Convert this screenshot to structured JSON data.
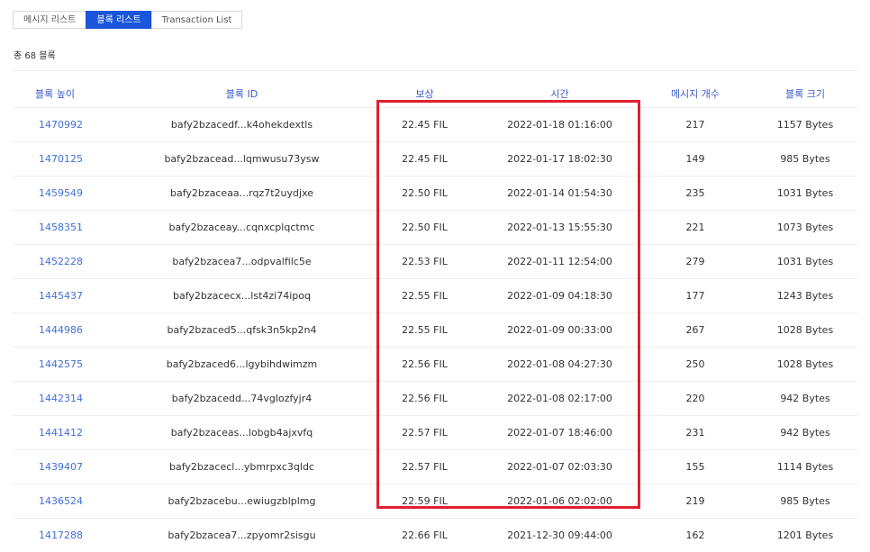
{
  "tabs": [
    {
      "label": "메시지 리스트",
      "active": false
    },
    {
      "label": "블록 리스트",
      "active": true
    },
    {
      "label": "Transaction List",
      "active": false
    }
  ],
  "summary": {
    "total_text": "총 68 블록"
  },
  "table": {
    "headers": {
      "height": "블록 높이",
      "id": "블록 ID",
      "reward": "보상",
      "time": "시간",
      "msg_count": "메시지 개수",
      "size": "블록 크기"
    },
    "rows": [
      {
        "height": "1470992",
        "id": "bafy2bzacedf...k4ohekdextls",
        "reward": "22.45 FIL",
        "time": "2022-01-18 01:16:00",
        "msg_count": "217",
        "size": "1157 Bytes"
      },
      {
        "height": "1470125",
        "id": "bafy2bzacead...lqmwusu73ysw",
        "reward": "22.45 FIL",
        "time": "2022-01-17 18:02:30",
        "msg_count": "149",
        "size": "985 Bytes"
      },
      {
        "height": "1459549",
        "id": "bafy2bzaceaa...rqz7t2uydjxe",
        "reward": "22.50 FIL",
        "time": "2022-01-14 01:54:30",
        "msg_count": "235",
        "size": "1031 Bytes"
      },
      {
        "height": "1458351",
        "id": "bafy2bzaceay...cqnxcplqctmc",
        "reward": "22.50 FIL",
        "time": "2022-01-13 15:55:30",
        "msg_count": "221",
        "size": "1073 Bytes"
      },
      {
        "height": "1452228",
        "id": "bafy2bzacea7...odpvalfilc5e",
        "reward": "22.53 FIL",
        "time": "2022-01-11 12:54:00",
        "msg_count": "279",
        "size": "1031 Bytes"
      },
      {
        "height": "1445437",
        "id": "bafy2bzacecx...lst4zi74ipoq",
        "reward": "22.55 FIL",
        "time": "2022-01-09 04:18:30",
        "msg_count": "177",
        "size": "1243 Bytes"
      },
      {
        "height": "1444986",
        "id": "bafy2bzaced5...qfsk3n5kp2n4",
        "reward": "22.55 FIL",
        "time": "2022-01-09 00:33:00",
        "msg_count": "267",
        "size": "1028 Bytes"
      },
      {
        "height": "1442575",
        "id": "bafy2bzaced6...lgybihdwimzm",
        "reward": "22.56 FIL",
        "time": "2022-01-08 04:27:30",
        "msg_count": "250",
        "size": "1028 Bytes"
      },
      {
        "height": "1442314",
        "id": "bafy2bzacedd...74vglozfyjr4",
        "reward": "22.56 FIL",
        "time": "2022-01-08 02:17:00",
        "msg_count": "220",
        "size": "942 Bytes"
      },
      {
        "height": "1441412",
        "id": "bafy2bzaceas...lobgb4ajxvfq",
        "reward": "22.57 FIL",
        "time": "2022-01-07 18:46:00",
        "msg_count": "231",
        "size": "942 Bytes"
      },
      {
        "height": "1439407",
        "id": "bafy2bzacecl...ybmrpxc3qldc",
        "reward": "22.57 FIL",
        "time": "2022-01-07 02:03:30",
        "msg_count": "155",
        "size": "1114 Bytes"
      },
      {
        "height": "1436524",
        "id": "bafy2bzacebu...ewiugzblplmg",
        "reward": "22.59 FIL",
        "time": "2022-01-06 02:02:00",
        "msg_count": "219",
        "size": "985 Bytes"
      },
      {
        "height": "1417288",
        "id": "bafy2bzacea7...zpyomr2sisgu",
        "reward": "22.66 FIL",
        "time": "2021-12-30 09:44:00",
        "msg_count": "162",
        "size": "1201 Bytes"
      }
    ]
  },
  "colors": {
    "accent": "#1a56db",
    "link": "#3f6fd8",
    "header_text": "#3a5bc7",
    "highlight_border": "#e0202e"
  }
}
